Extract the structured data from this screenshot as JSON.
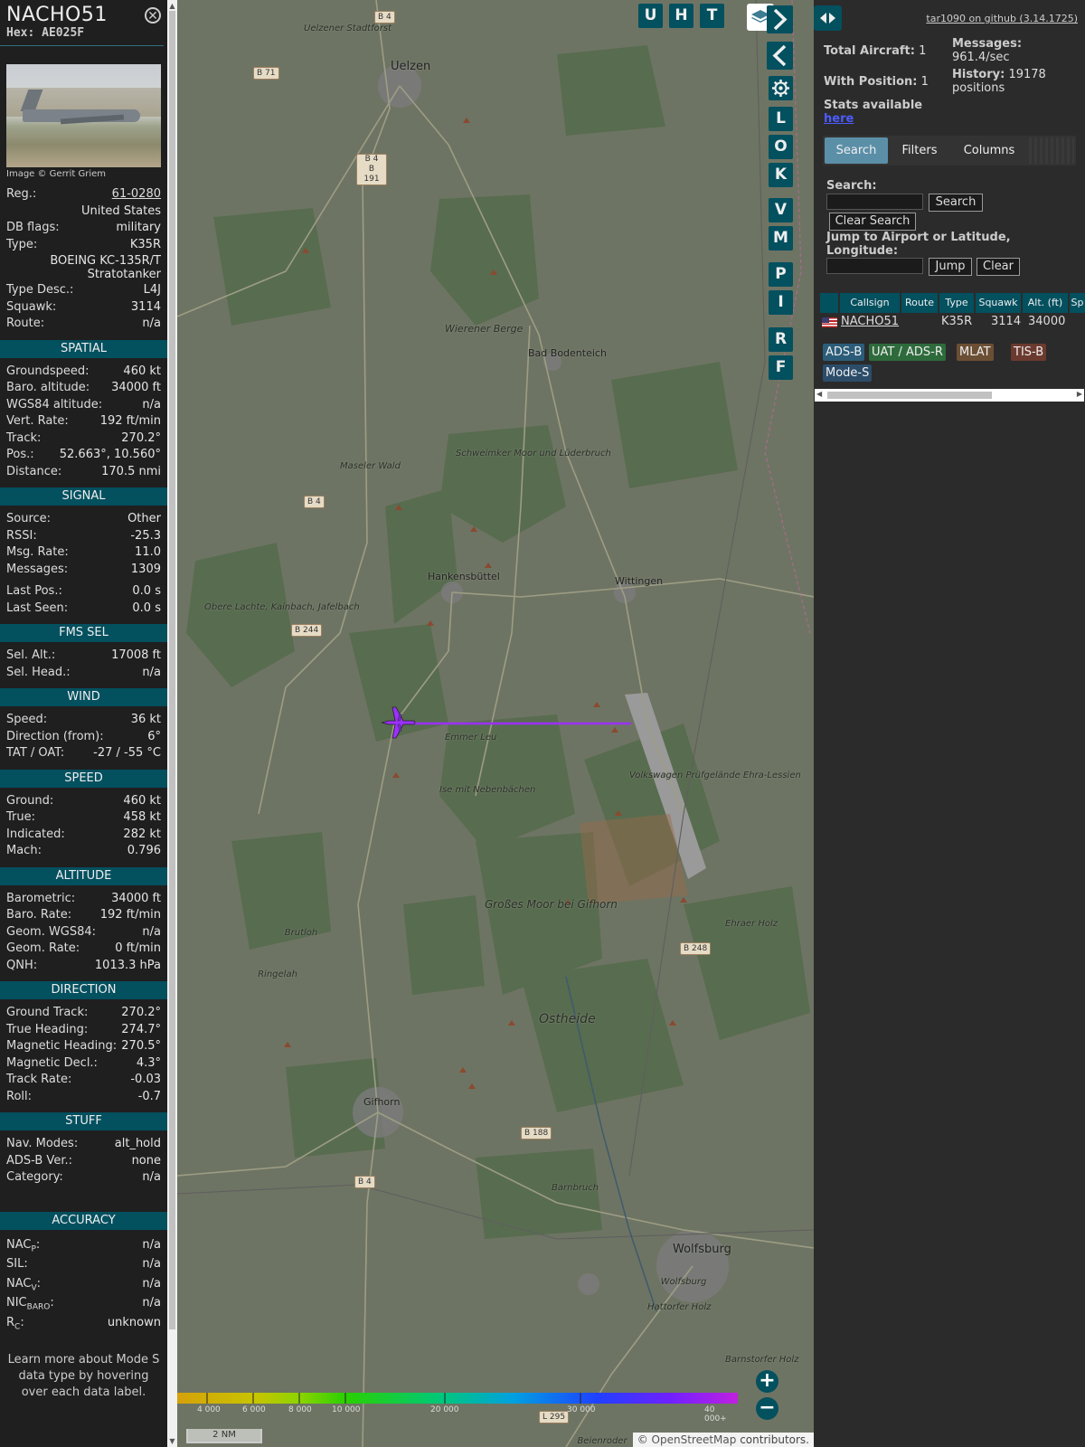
{
  "info": {
    "callsign": "NACHO51",
    "hex_label": "Hex:",
    "hex": "AE025F",
    "photo_credit": "Image © Gerrit Griem",
    "details": [
      {
        "label": "Reg.:",
        "value": "61-0280",
        "link": true
      },
      {
        "label": "",
        "value": "United States"
      },
      {
        "label": "DB flags:",
        "value": "military"
      },
      {
        "label": "Type:",
        "value": "K35R"
      },
      {
        "label": "",
        "value": "BOEING KC-135R/T Stratotanker",
        "tall": true
      },
      {
        "label": "Type Desc.:",
        "value": "L4J"
      },
      {
        "label": "Squawk:",
        "value": "3114"
      },
      {
        "label": "Route:",
        "value": "n/a"
      }
    ],
    "sections": [
      {
        "title": "SPATIAL",
        "rows": [
          {
            "label": "Groundspeed:",
            "value": "460 kt"
          },
          {
            "label": "Baro. altitude:",
            "value": "34000 ft"
          },
          {
            "label": "WGS84 altitude:",
            "value": "n/a"
          },
          {
            "label": "Vert. Rate:",
            "value": "192 ft/min"
          },
          {
            "label": "Track:",
            "value": "270.2°"
          },
          {
            "label": "Pos.:",
            "value": "52.663°, 10.560°"
          },
          {
            "label": "Distance:",
            "value": "170.5 nmi"
          }
        ]
      },
      {
        "title": "SIGNAL",
        "rows": [
          {
            "label": "Source:",
            "value": "Other"
          },
          {
            "label": "RSSI:",
            "value": "-25.3"
          },
          {
            "label": "Msg. Rate:",
            "value": "11.0"
          },
          {
            "label": "Messages:",
            "value": "1309"
          },
          {
            "label": "Last Pos.:",
            "value": "0.0 s",
            "gap": true
          },
          {
            "label": "Last Seen:",
            "value": "0.0 s"
          }
        ]
      },
      {
        "title": "FMS SEL",
        "rows": [
          {
            "label": "Sel. Alt.:",
            "value": "17008 ft"
          },
          {
            "label": "Sel. Head.:",
            "value": "n/a"
          }
        ]
      },
      {
        "title": "WIND",
        "rows": [
          {
            "label": "Speed:",
            "value": "36 kt"
          },
          {
            "label": "Direction (from):",
            "value": "6°"
          },
          {
            "label": "TAT / OAT:",
            "value": "-27 / -55 °C"
          }
        ]
      },
      {
        "title": "SPEED",
        "rows": [
          {
            "label": "Ground:",
            "value": "460 kt"
          },
          {
            "label": "True:",
            "value": "458 kt"
          },
          {
            "label": "Indicated:",
            "value": "282 kt"
          },
          {
            "label": "Mach:",
            "value": "0.796"
          }
        ]
      },
      {
        "title": "ALTITUDE",
        "rows": [
          {
            "label": "Barometric:",
            "value": "34000 ft"
          },
          {
            "label": "Baro. Rate:",
            "value": "192 ft/min"
          },
          {
            "label": "Geom. WGS84:",
            "value": "n/a"
          },
          {
            "label": "Geom. Rate:",
            "value": "0 ft/min"
          },
          {
            "label": "QNH:",
            "value": "1013.3 hPa"
          }
        ]
      },
      {
        "title": "DIRECTION",
        "rows": [
          {
            "label": "Ground Track:",
            "value": "270.2°"
          },
          {
            "label": "True Heading:",
            "value": "274.7°"
          },
          {
            "label": "Magnetic Heading:",
            "value": "270.5°"
          },
          {
            "label": "Magnetic Decl.:",
            "value": "4.3°"
          },
          {
            "label": "Track Rate:",
            "value": "-0.03"
          },
          {
            "label": "Roll:",
            "value": "-0.7"
          }
        ]
      },
      {
        "title": "STUFF",
        "rows": [
          {
            "label": "Nav. Modes:",
            "value": "alt_hold"
          },
          {
            "label": "ADS-B Ver.:",
            "value": "none"
          },
          {
            "label": "Category:",
            "value": "n/a"
          }
        ]
      }
    ],
    "accuracy": {
      "title": "ACCURACY",
      "rows": [
        {
          "label": "NAC",
          "sub": "P",
          "value": "n/a"
        },
        {
          "label": "SIL:",
          "sub": "",
          "value": "n/a"
        },
        {
          "label": "NAC",
          "sub": "V",
          "value": "n/a"
        },
        {
          "label": "NIC",
          "sub": "BARO",
          "value": "n/a"
        },
        {
          "label": "R",
          "sub": "C",
          "value": "unknown"
        }
      ]
    },
    "footer": "Learn more about Mode S data type by hovering over each data label."
  },
  "map": {
    "top_buttons": [
      "U",
      "H",
      "T"
    ],
    "side_buttons": [
      "L",
      "O",
      "K",
      "V",
      "M",
      "P",
      "I",
      "R",
      "F"
    ],
    "towns": [
      {
        "name": "Uelzen",
        "big": true
      },
      {
        "name": "Bad Bodenteich"
      },
      {
        "name": "Hankensbüttel"
      },
      {
        "name": "Wittingen"
      },
      {
        "name": "Gifhorn"
      },
      {
        "name": "Wolfsburg",
        "big": true
      }
    ],
    "areas": [
      "Uelzener Stadtforst",
      "Wierener Berge",
      "Schweimker Moor und Lüderbruch",
      "Maseler Wald",
      "Obere Lachte, Kainbach, Jafelbach",
      "Emmer Leu",
      "Ise mit Nebenbächen",
      "Volkswagen Prüfgelände Ehra-Lessien",
      "Großes Moor bei Gifhorn",
      "Ostheide",
      "Brutloh",
      "Ringelah",
      "Ehraer Holz",
      "Barnbruch",
      "Hattorfer Holz",
      "Wolfsburg",
      "Barnstorfer Holz",
      "Beienroder"
    ],
    "roads": [
      "B 4",
      "B 71",
      "B 4",
      "B 191",
      "B 4",
      "B 244",
      "B 248",
      "B 188",
      "B 4",
      "L 295"
    ],
    "colorbar_labels": [
      "4 000",
      "6 000",
      "8 000",
      "10 000",
      "20 000",
      "30 000",
      "40 000+"
    ],
    "scale": "2 NM",
    "attribution_prefix": "©",
    "attribution_link": "OpenStreetMap",
    "attribution_suffix": "contributors.",
    "zoom_in": "+",
    "zoom_out": "−",
    "aircraft_color": "#9b30ff"
  },
  "sidebar": {
    "version": "tar1090 on github (3.14.1725)",
    "total_aircraft_label": "Total Aircraft:",
    "total_aircraft": "1",
    "with_position_label": "With Position:",
    "with_position": "1",
    "messages_label": "Messages:",
    "messages_rate": "961.4/sec",
    "history_label": "History:",
    "history": "19178 positions",
    "stats_label": "Stats available",
    "stats_link": "here",
    "tabs": [
      "Search",
      "Filters",
      "Columns"
    ],
    "search_label": "Search:",
    "search_button": "Search",
    "clear_search_button": "Clear Search",
    "jump_label": "Jump to Airport or Latitude, Longitude:",
    "jump_button": "Jump",
    "clear_button": "Clear",
    "table_headers": [
      "Callsign",
      "Route",
      "Type",
      "Squawk",
      "Alt. (ft)",
      "Sp"
    ],
    "table_row": {
      "callsign": "NACHO51",
      "route": "",
      "type": "K35R",
      "squawk": "3114",
      "alt": "34000"
    },
    "legend": [
      {
        "label": "ADS-B",
        "color": "#2b5d7a"
      },
      {
        "label": "UAT / ADS-R",
        "color": "#2e6b3c"
      },
      {
        "label": "MLAT",
        "color": "#6b4f34"
      },
      {
        "label": "TIS-B",
        "color": "#6b3a2e"
      },
      {
        "label": "Mode-S",
        "color": "#2b4d6a"
      }
    ]
  }
}
